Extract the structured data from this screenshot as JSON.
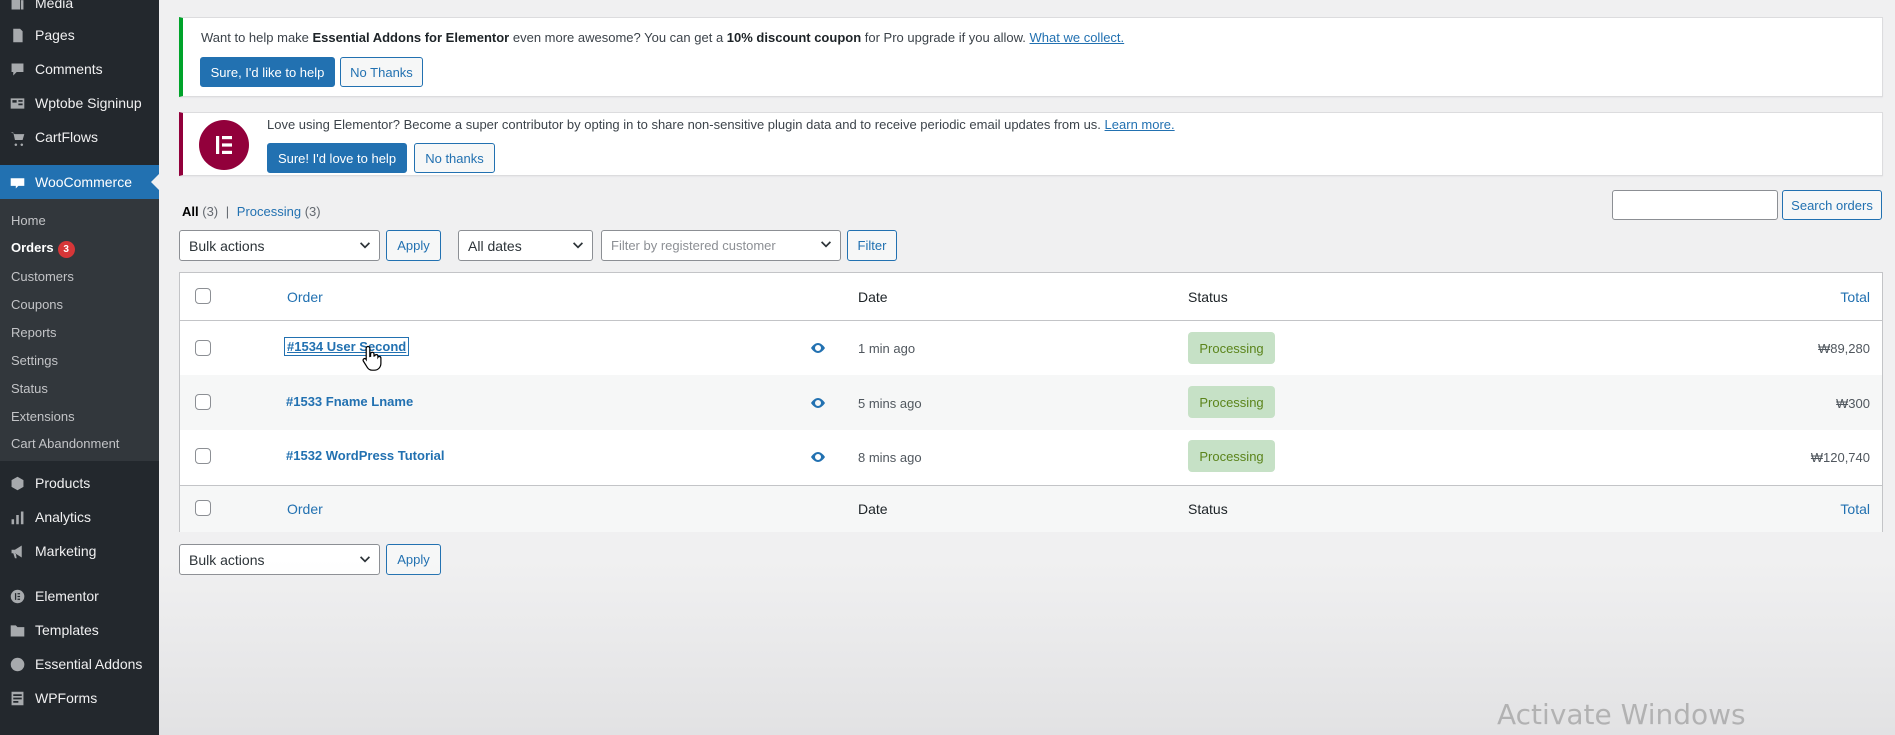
{
  "sidebar": {
    "items": [
      {
        "label": "Media",
        "icon": "media-icon"
      },
      {
        "label": "Pages",
        "icon": "pages-icon"
      },
      {
        "label": "Comments",
        "icon": "comments-icon"
      },
      {
        "label": "Wptobe Signinup",
        "icon": "form-icon"
      },
      {
        "label": "CartFlows",
        "icon": "cartflows-icon"
      },
      {
        "label": "WooCommerce",
        "icon": "woocommerce-icon"
      },
      {
        "label": "Products",
        "icon": "products-icon"
      },
      {
        "label": "Analytics",
        "icon": "analytics-icon"
      },
      {
        "label": "Marketing",
        "icon": "marketing-icon"
      },
      {
        "label": "Elementor",
        "icon": "elementor-icon"
      },
      {
        "label": "Templates",
        "icon": "templates-icon"
      },
      {
        "label": "Essential Addons",
        "icon": "essential-addons-icon"
      },
      {
        "label": "WPForms",
        "icon": "wpforms-icon"
      }
    ],
    "woo_submenu": [
      {
        "label": "Home"
      },
      {
        "label": "Orders",
        "badge": "3"
      },
      {
        "label": "Customers"
      },
      {
        "label": "Coupons"
      },
      {
        "label": "Reports"
      },
      {
        "label": "Settings"
      },
      {
        "label": "Status"
      },
      {
        "label": "Extensions"
      },
      {
        "label": "Cart Abandonment"
      }
    ]
  },
  "notices": {
    "ea": {
      "text_1": "Want to help make ",
      "bold_1": "Essential Addons for Elementor",
      "text_2": " even more awesome? You can get a ",
      "bold_2": "10% discount coupon",
      "text_3": " for Pro upgrade if you allow. ",
      "link": "What we collect.",
      "accept_label": "Sure, I'd like to help",
      "decline_label": "No Thanks"
    },
    "elementor": {
      "text": "Love using Elementor? Become a super contributor by opting in to share non-sensitive plugin data and to receive periodic email updates from us. ",
      "link": "Learn more.",
      "accept_label": "Sure! I'd love to help",
      "decline_label": "No thanks"
    }
  },
  "filters": {
    "all_label": "All",
    "all_count": "(3)",
    "separator": "|",
    "processing_label": "Processing",
    "processing_count": "(3)",
    "bulk_actions": "Bulk actions",
    "apply_label": "Apply",
    "dates": "All dates",
    "customer_placeholder": "Filter by registered customer",
    "filter_label": "Filter",
    "search_label": "Search orders"
  },
  "table": {
    "columns": {
      "order": "Order",
      "date": "Date",
      "status": "Status",
      "total": "Total"
    },
    "rows": [
      {
        "order": "#1534 User Second",
        "date": "1 min ago",
        "status": "Processing",
        "total": "₩89,280"
      },
      {
        "order": "#1533 Fname Lname",
        "date": "5 mins ago",
        "status": "Processing",
        "total": "₩300"
      },
      {
        "order": "#1532 WordPress Tutorial",
        "date": "8 mins ago",
        "status": "Processing",
        "total": "₩120,740"
      }
    ]
  },
  "bottom": {
    "bulk_actions": "Bulk actions",
    "apply_label": "Apply"
  },
  "watermark": "Activate Windows",
  "colors": {
    "sidebar": "#23282d",
    "accent": "#2271b1",
    "status_bg": "#c6e1c6",
    "status_text": "#5b841b"
  }
}
